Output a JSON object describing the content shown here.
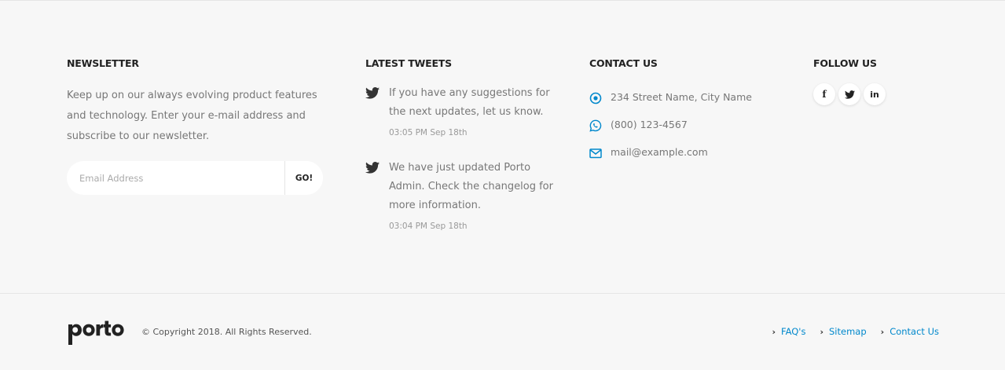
{
  "newsletter": {
    "title": "NEWSLETTER",
    "text": "Keep up on our always evolving product features and technology. Enter your e-mail address and subscribe to our newsletter.",
    "placeholder": "Email Address",
    "button": "GO!"
  },
  "tweets": {
    "title": "LATEST TWEETS",
    "items": [
      {
        "text": "If you have any suggestions for the next updates, let us know.",
        "time": "03:05 PM Sep 18th",
        "icon": "twitter-icon"
      },
      {
        "text": "We have just updated Porto Admin. Check the changelog for more information.",
        "time": "03:04 PM Sep 18th",
        "icon": "twitter-icon"
      }
    ]
  },
  "contact": {
    "title": "CONTACT US",
    "address": "234 Street Name, City Name",
    "phone": "(800) 123-4567",
    "email": "mail@example.com",
    "icon_color": "#0088cc"
  },
  "follow": {
    "title": "FOLLOW US",
    "links": [
      {
        "icon": "facebook-icon",
        "glyph": "f"
      },
      {
        "icon": "twitter-icon",
        "glyph": "t"
      },
      {
        "icon": "linkedin-icon",
        "glyph": "in"
      }
    ]
  },
  "footer": {
    "logo": "porto",
    "copyright": "© Copyright 2018. All Rights Reserved.",
    "links": [
      "FAQ's",
      "Sitemap",
      "Contact Us"
    ],
    "link_color": "#0088cc"
  }
}
